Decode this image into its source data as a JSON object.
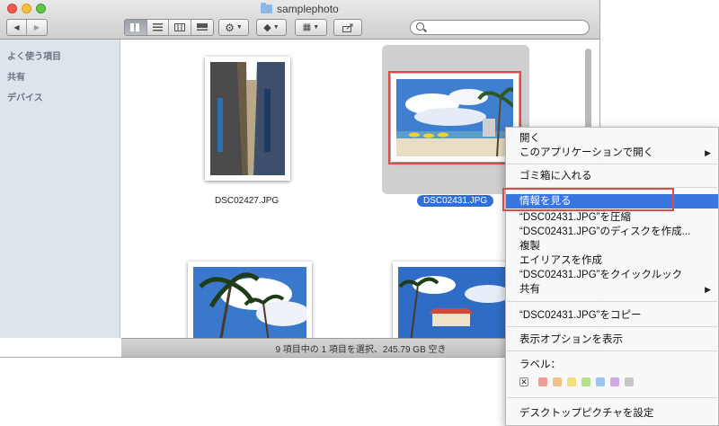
{
  "window": {
    "title": "samplephoto"
  },
  "toolbar": {
    "back_label": "◀",
    "forward_label": "▶",
    "search_placeholder": ""
  },
  "sidebar": {
    "sections": [
      {
        "label": "よく使う項目"
      },
      {
        "label": "共有"
      },
      {
        "label": "デバイス"
      }
    ]
  },
  "files": [
    {
      "name": "DSC02427.JPG"
    },
    {
      "name": "DSC02431.JPG"
    }
  ],
  "status": {
    "text": "9 項目中の 1 項目を選択、245.79 GB 空き"
  },
  "context_menu": {
    "items": [
      {
        "label": "開く"
      },
      {
        "label": "このアプリケーションで開く"
      },
      {
        "label": "ゴミ箱に入れる"
      },
      {
        "label": "情報を見る"
      },
      {
        "label": "“DSC02431.JPG”を圧縮"
      },
      {
        "label": "“DSC02431.JPG”のディスクを作成..."
      },
      {
        "label": "複製"
      },
      {
        "label": "エイリアスを作成"
      },
      {
        "label": "“DSC02431.JPG”をクイックルック"
      },
      {
        "label": "共有"
      },
      {
        "label": "“DSC02431.JPG”をコピー"
      },
      {
        "label": "表示オプションを表示"
      },
      {
        "label": "ラベル："
      },
      {
        "label": "デスクトップピクチャを設定"
      }
    ],
    "submenu_arrow": "▶",
    "label_none_mark": "✕",
    "label_colors": [
      "#f29a96",
      "#f6c089",
      "#f2e07a",
      "#b6e08c",
      "#9cc4f2",
      "#d2a8e6",
      "#c6c6c6"
    ]
  },
  "colors": {
    "selection": "#3a76e0",
    "highlight_box": "#e04a4a"
  }
}
